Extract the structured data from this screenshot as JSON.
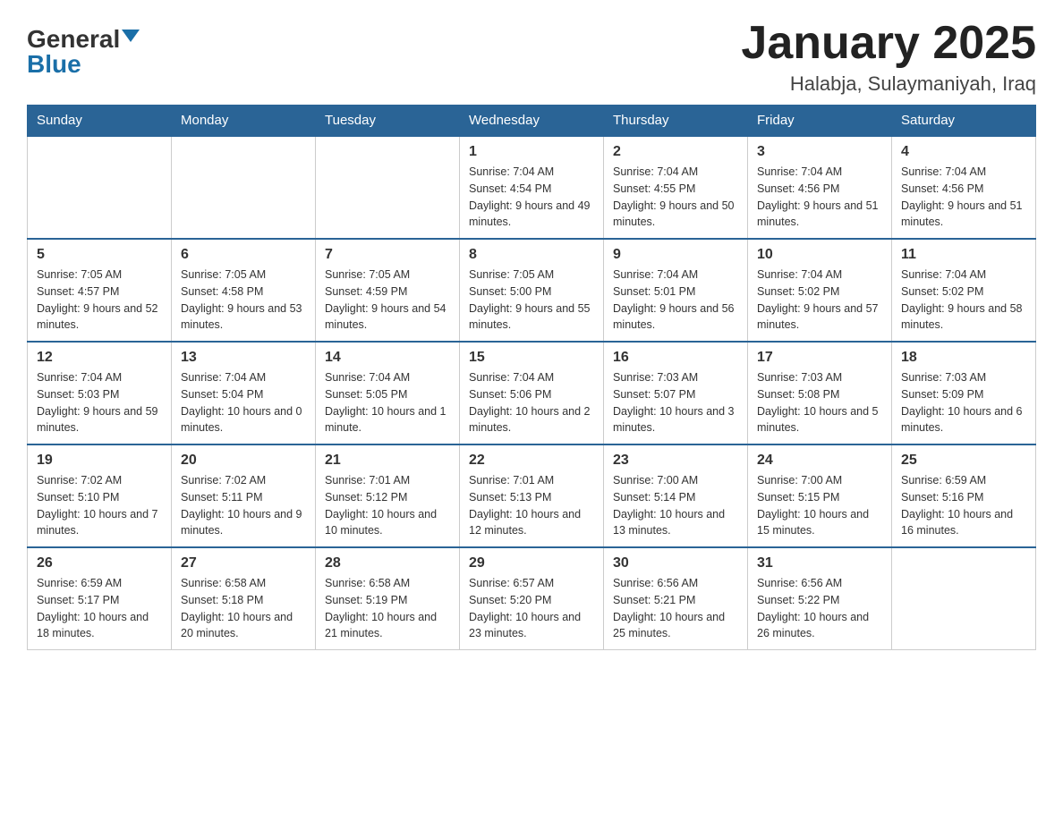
{
  "header": {
    "logo_general": "General",
    "logo_blue": "Blue",
    "month_title": "January 2025",
    "location": "Halabja, Sulaymaniyah, Iraq"
  },
  "days_of_week": [
    "Sunday",
    "Monday",
    "Tuesday",
    "Wednesday",
    "Thursday",
    "Friday",
    "Saturday"
  ],
  "weeks": [
    [
      {
        "day": "",
        "info": ""
      },
      {
        "day": "",
        "info": ""
      },
      {
        "day": "",
        "info": ""
      },
      {
        "day": "1",
        "info": "Sunrise: 7:04 AM\nSunset: 4:54 PM\nDaylight: 9 hours and 49 minutes."
      },
      {
        "day": "2",
        "info": "Sunrise: 7:04 AM\nSunset: 4:55 PM\nDaylight: 9 hours and 50 minutes."
      },
      {
        "day": "3",
        "info": "Sunrise: 7:04 AM\nSunset: 4:56 PM\nDaylight: 9 hours and 51 minutes."
      },
      {
        "day": "4",
        "info": "Sunrise: 7:04 AM\nSunset: 4:56 PM\nDaylight: 9 hours and 51 minutes."
      }
    ],
    [
      {
        "day": "5",
        "info": "Sunrise: 7:05 AM\nSunset: 4:57 PM\nDaylight: 9 hours and 52 minutes."
      },
      {
        "day": "6",
        "info": "Sunrise: 7:05 AM\nSunset: 4:58 PM\nDaylight: 9 hours and 53 minutes."
      },
      {
        "day": "7",
        "info": "Sunrise: 7:05 AM\nSunset: 4:59 PM\nDaylight: 9 hours and 54 minutes."
      },
      {
        "day": "8",
        "info": "Sunrise: 7:05 AM\nSunset: 5:00 PM\nDaylight: 9 hours and 55 minutes."
      },
      {
        "day": "9",
        "info": "Sunrise: 7:04 AM\nSunset: 5:01 PM\nDaylight: 9 hours and 56 minutes."
      },
      {
        "day": "10",
        "info": "Sunrise: 7:04 AM\nSunset: 5:02 PM\nDaylight: 9 hours and 57 minutes."
      },
      {
        "day": "11",
        "info": "Sunrise: 7:04 AM\nSunset: 5:02 PM\nDaylight: 9 hours and 58 minutes."
      }
    ],
    [
      {
        "day": "12",
        "info": "Sunrise: 7:04 AM\nSunset: 5:03 PM\nDaylight: 9 hours and 59 minutes."
      },
      {
        "day": "13",
        "info": "Sunrise: 7:04 AM\nSunset: 5:04 PM\nDaylight: 10 hours and 0 minutes."
      },
      {
        "day": "14",
        "info": "Sunrise: 7:04 AM\nSunset: 5:05 PM\nDaylight: 10 hours and 1 minute."
      },
      {
        "day": "15",
        "info": "Sunrise: 7:04 AM\nSunset: 5:06 PM\nDaylight: 10 hours and 2 minutes."
      },
      {
        "day": "16",
        "info": "Sunrise: 7:03 AM\nSunset: 5:07 PM\nDaylight: 10 hours and 3 minutes."
      },
      {
        "day": "17",
        "info": "Sunrise: 7:03 AM\nSunset: 5:08 PM\nDaylight: 10 hours and 5 minutes."
      },
      {
        "day": "18",
        "info": "Sunrise: 7:03 AM\nSunset: 5:09 PM\nDaylight: 10 hours and 6 minutes."
      }
    ],
    [
      {
        "day": "19",
        "info": "Sunrise: 7:02 AM\nSunset: 5:10 PM\nDaylight: 10 hours and 7 minutes."
      },
      {
        "day": "20",
        "info": "Sunrise: 7:02 AM\nSunset: 5:11 PM\nDaylight: 10 hours and 9 minutes."
      },
      {
        "day": "21",
        "info": "Sunrise: 7:01 AM\nSunset: 5:12 PM\nDaylight: 10 hours and 10 minutes."
      },
      {
        "day": "22",
        "info": "Sunrise: 7:01 AM\nSunset: 5:13 PM\nDaylight: 10 hours and 12 minutes."
      },
      {
        "day": "23",
        "info": "Sunrise: 7:00 AM\nSunset: 5:14 PM\nDaylight: 10 hours and 13 minutes."
      },
      {
        "day": "24",
        "info": "Sunrise: 7:00 AM\nSunset: 5:15 PM\nDaylight: 10 hours and 15 minutes."
      },
      {
        "day": "25",
        "info": "Sunrise: 6:59 AM\nSunset: 5:16 PM\nDaylight: 10 hours and 16 minutes."
      }
    ],
    [
      {
        "day": "26",
        "info": "Sunrise: 6:59 AM\nSunset: 5:17 PM\nDaylight: 10 hours and 18 minutes."
      },
      {
        "day": "27",
        "info": "Sunrise: 6:58 AM\nSunset: 5:18 PM\nDaylight: 10 hours and 20 minutes."
      },
      {
        "day": "28",
        "info": "Sunrise: 6:58 AM\nSunset: 5:19 PM\nDaylight: 10 hours and 21 minutes."
      },
      {
        "day": "29",
        "info": "Sunrise: 6:57 AM\nSunset: 5:20 PM\nDaylight: 10 hours and 23 minutes."
      },
      {
        "day": "30",
        "info": "Sunrise: 6:56 AM\nSunset: 5:21 PM\nDaylight: 10 hours and 25 minutes."
      },
      {
        "day": "31",
        "info": "Sunrise: 6:56 AM\nSunset: 5:22 PM\nDaylight: 10 hours and 26 minutes."
      },
      {
        "day": "",
        "info": ""
      }
    ]
  ]
}
